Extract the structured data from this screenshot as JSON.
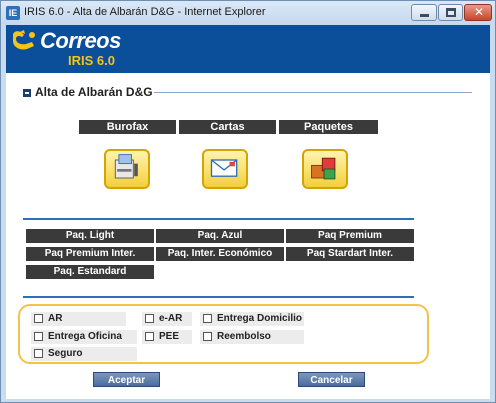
{
  "window": {
    "title": "IRIS 6.0 - Alta de Albarán D&G - Internet Explorer",
    "icon_label": "IE",
    "controls": [
      "minimize-icon",
      "maximize-icon",
      "close-icon"
    ],
    "close_glyph": "✕"
  },
  "header": {
    "brand": "Correos",
    "product": "IRIS 6.0",
    "background_color": "#0b4f9b",
    "product_color": "#f6c21c"
  },
  "section": {
    "title": "Alta de Albarán D&G"
  },
  "categories": [
    {
      "label": "Burofax",
      "icon": "burofax-icon"
    },
    {
      "label": "Cartas",
      "icon": "envelope-icon"
    },
    {
      "label": "Paquetes",
      "icon": "packages-icon"
    }
  ],
  "package_types": [
    "Paq. Light",
    "Paq. Azul",
    "Paq Premium",
    "Paq Premium Inter.",
    "Paq. Inter. Económico",
    "Paq Stardart Inter.",
    "Paq. Estandard"
  ],
  "options": [
    {
      "label": "AR",
      "checked": false
    },
    {
      "label": "e-AR",
      "checked": false
    },
    {
      "label": "Entrega Domicilio",
      "checked": false
    },
    {
      "label": "Entrega Oficina",
      "checked": false
    },
    {
      "label": "PEE",
      "checked": false
    },
    {
      "label": "Reembolso",
      "checked": false
    },
    {
      "label": "Seguro",
      "checked": false
    }
  ],
  "buttons": {
    "accept": "Aceptar",
    "cancel": "Cancelar"
  },
  "colors": {
    "accent_blue": "#2f6fb8",
    "option_border": "#f0c34a",
    "dark_button": "#3a3a3a"
  }
}
